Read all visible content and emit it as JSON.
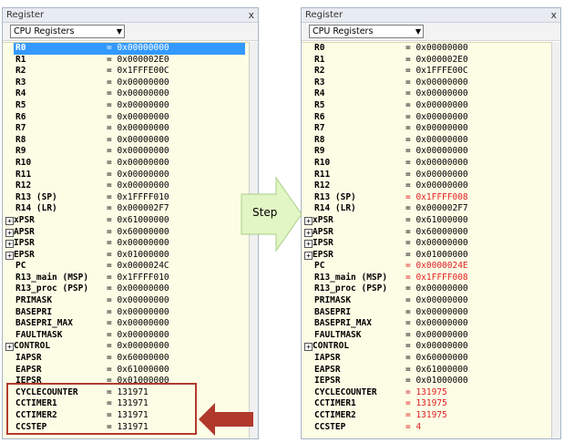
{
  "left_panel": {
    "title": "Register",
    "close": "x",
    "dropdown": "CPU Registers",
    "rows": [
      {
        "name": "R0",
        "value": "= 0x00000000",
        "selected": true
      },
      {
        "name": "R1",
        "value": "= 0x000002E0"
      },
      {
        "name": "R2",
        "value": "= 0x1FFFE00C"
      },
      {
        "name": "R3",
        "value": "= 0x00000000"
      },
      {
        "name": "R4",
        "value": "= 0x00000000"
      },
      {
        "name": "R5",
        "value": "= 0x00000000"
      },
      {
        "name": "R6",
        "value": "= 0x00000000"
      },
      {
        "name": "R7",
        "value": "= 0x00000000"
      },
      {
        "name": "R8",
        "value": "= 0x00000000"
      },
      {
        "name": "R9",
        "value": "= 0x00000000"
      },
      {
        "name": "R10",
        "value": "= 0x00000000"
      },
      {
        "name": "R11",
        "value": "= 0x00000000"
      },
      {
        "name": "R12",
        "value": "= 0x00000000"
      },
      {
        "name": "R13 (SP)",
        "value": "= 0x1FFFF010"
      },
      {
        "name": "R14 (LR)",
        "value": "= 0x000002F7"
      },
      {
        "name": "xPSR",
        "value": "= 0x61000000",
        "expand": true
      },
      {
        "name": "APSR",
        "value": "= 0x60000000",
        "expand": true
      },
      {
        "name": "IPSR",
        "value": "= 0x00000000",
        "expand": true
      },
      {
        "name": "EPSR",
        "value": "= 0x01000000",
        "expand": true
      },
      {
        "name": "PC",
        "value": "= 0x0000024C"
      },
      {
        "name": "R13_main (MSP)",
        "value": "= 0x1FFFF010"
      },
      {
        "name": "R13_proc (PSP)",
        "value": "= 0x00000000"
      },
      {
        "name": "PRIMASK",
        "value": "= 0x00000000"
      },
      {
        "name": "BASEPRI",
        "value": "= 0x00000000"
      },
      {
        "name": "BASEPRI_MAX",
        "value": "= 0x00000000"
      },
      {
        "name": "FAULTMASK",
        "value": "= 0x00000000"
      },
      {
        "name": "CONTROL",
        "value": "= 0x00000000",
        "expand": true
      },
      {
        "name": "IAPSR",
        "value": "= 0x60000000"
      },
      {
        "name": "EAPSR",
        "value": "= 0x61000000"
      },
      {
        "name": "IEPSR",
        "value": "= 0x01000000"
      },
      {
        "name": "CYCLECOUNTER",
        "value": "= 131971"
      },
      {
        "name": "CCTIMER1",
        "value": "= 131971"
      },
      {
        "name": "CCTIMER2",
        "value": "= 131971"
      },
      {
        "name": "CCSTEP",
        "value": "= 131971"
      }
    ]
  },
  "right_panel": {
    "title": "Register",
    "close": "x",
    "dropdown": "CPU Registers",
    "rows": [
      {
        "name": "R0",
        "value": "= 0x00000000"
      },
      {
        "name": "R1",
        "value": "= 0x000002E0"
      },
      {
        "name": "R2",
        "value": "= 0x1FFFE00C"
      },
      {
        "name": "R3",
        "value": "= 0x00000000"
      },
      {
        "name": "R4",
        "value": "= 0x00000000"
      },
      {
        "name": "R5",
        "value": "= 0x00000000"
      },
      {
        "name": "R6",
        "value": "= 0x00000000"
      },
      {
        "name": "R7",
        "value": "= 0x00000000"
      },
      {
        "name": "R8",
        "value": "= 0x00000000"
      },
      {
        "name": "R9",
        "value": "= 0x00000000"
      },
      {
        "name": "R10",
        "value": "= 0x00000000"
      },
      {
        "name": "R11",
        "value": "= 0x00000000"
      },
      {
        "name": "R12",
        "value": "= 0x00000000"
      },
      {
        "name": "R13 (SP)",
        "value": "= 0x1FFFF008",
        "changed": true
      },
      {
        "name": "R14 (LR)",
        "value": "= 0x000002F7"
      },
      {
        "name": "xPSR",
        "value": "= 0x61000000",
        "expand": true
      },
      {
        "name": "APSR",
        "value": "= 0x60000000",
        "expand": true
      },
      {
        "name": "IPSR",
        "value": "= 0x00000000",
        "expand": true
      },
      {
        "name": "EPSR",
        "value": "= 0x01000000",
        "expand": true
      },
      {
        "name": "PC",
        "value": "= 0x0000024E",
        "changed": true
      },
      {
        "name": "R13_main (MSP)",
        "value": "= 0x1FFFF008",
        "changed": true
      },
      {
        "name": "R13_proc (PSP)",
        "value": "= 0x00000000"
      },
      {
        "name": "PRIMASK",
        "value": "= 0x00000000"
      },
      {
        "name": "BASEPRI",
        "value": "= 0x00000000"
      },
      {
        "name": "BASEPRI_MAX",
        "value": "= 0x00000000"
      },
      {
        "name": "FAULTMASK",
        "value": "= 0x00000000"
      },
      {
        "name": "CONTROL",
        "value": "= 0x00000000",
        "expand": true
      },
      {
        "name": "IAPSR",
        "value": "= 0x60000000"
      },
      {
        "name": "EAPSR",
        "value": "= 0x61000000"
      },
      {
        "name": "IEPSR",
        "value": "= 0x01000000"
      },
      {
        "name": "CYCLECOUNTER",
        "value": "= 131975",
        "changed": true
      },
      {
        "name": "CCTIMER1",
        "value": "= 131975",
        "changed": true
      },
      {
        "name": "CCTIMER2",
        "value": "= 131975",
        "changed": true
      },
      {
        "name": "CCSTEP",
        "value": "= 4",
        "changed": true
      }
    ]
  },
  "step_label": "Step",
  "colors": {
    "changed_value": "#e02020",
    "list_background": "#fdfde6",
    "selection": "#3399ff",
    "highlight_box": "#b23b2e",
    "step_arrow_fill": "#e2f5c4",
    "red_arrow_fill": "#b0392c"
  }
}
